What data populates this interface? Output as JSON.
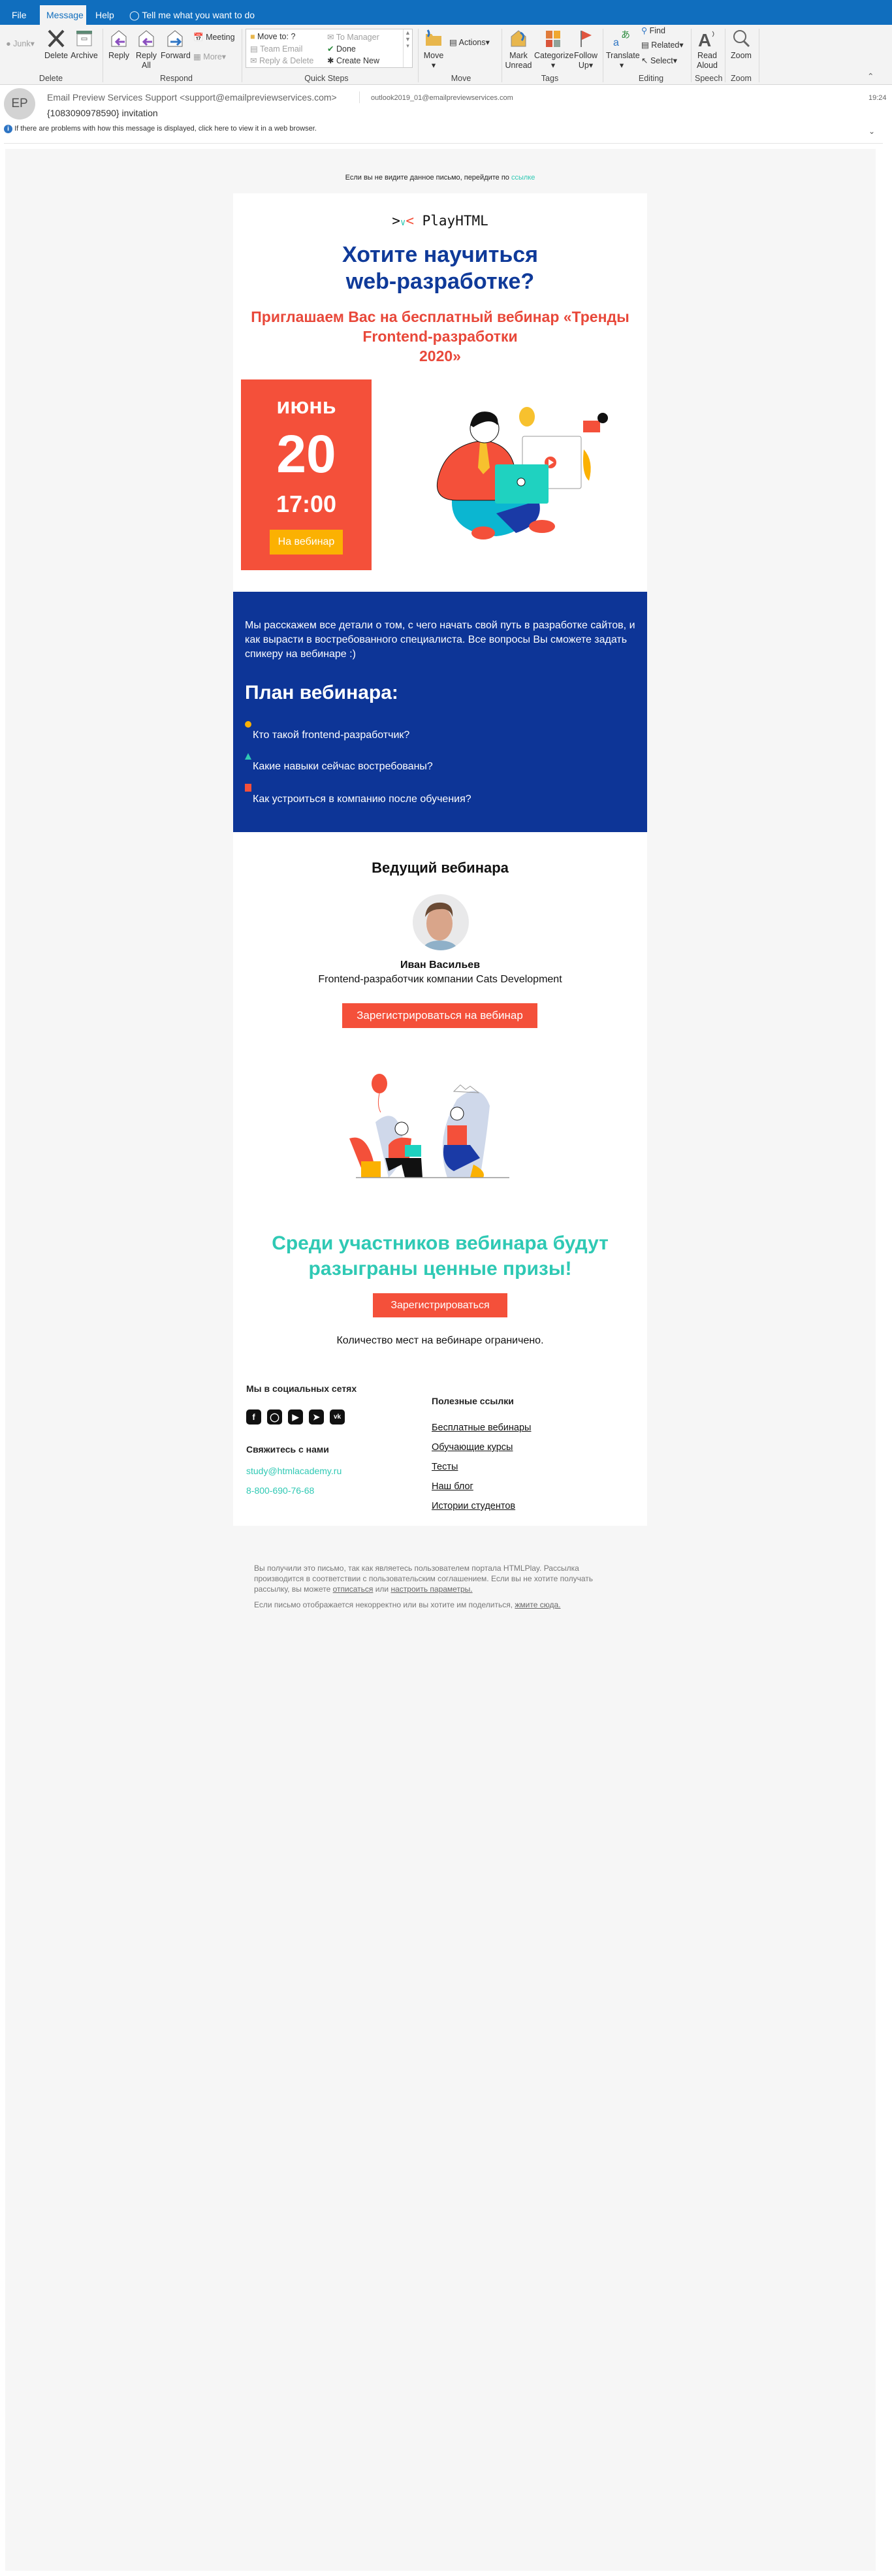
{
  "tabs": {
    "file": "File",
    "message": "Message",
    "help": "Help",
    "tell_me": "Tell me what you want to do"
  },
  "ribbon": {
    "junk": "Junk",
    "delete": "Delete",
    "archive": "Archive",
    "group_delete": "Delete",
    "reply": "Reply",
    "reply_all_1": "Reply",
    "reply_all_2": "All",
    "forward": "Forward",
    "meeting": "Meeting",
    "more": "More",
    "group_respond": "Respond",
    "qs_move_to": "Move to: ?",
    "qs_team_email": "Team Email",
    "qs_reply_delete": "Reply & Delete",
    "qs_to_manager": "To Manager",
    "qs_done": "Done",
    "qs_create_new": "Create New",
    "group_quick_steps": "Quick Steps",
    "move": "Move",
    "actions": "Actions",
    "group_move": "Move",
    "mark_unread_1": "Mark",
    "mark_unread_2": "Unread",
    "categorize": "Categorize",
    "follow_up_1": "Follow",
    "follow_up_2": "Up",
    "group_tags": "Tags",
    "translate": "Translate",
    "find": "Find",
    "related": "Related",
    "select": "Select",
    "group_editing": "Editing",
    "read_aloud_1": "Read",
    "read_aloud_2": "Aloud",
    "group_speech": "Speech",
    "zoom": "Zoom",
    "group_zoom": "Zoom"
  },
  "header": {
    "avatar": "EP",
    "sender": "Email Preview Services Support <support@emailpreviewservices.com>",
    "recipient": "outlook2019_01@emailpreviewservices.com",
    "time": "19:24",
    "subject": "{1083090978590} invitation",
    "info": "If there are problems with how this message is displayed, click here to view it in a web browser."
  },
  "email": {
    "preheader": "Если вы не видите данное письмо, перейдите по ",
    "preheader_link": "ссылке",
    "logo": "PlayHTML",
    "title_1": "Хотите научиться",
    "title_2": "web-разработке?",
    "subtitle_1": "Приглашаем Вас на бесплатный вебинар «Тренды",
    "subtitle_2": "Frontend-разработки",
    "subtitle_3": "2020»",
    "month": "июнь",
    "day": "20",
    "time": "17:00",
    "webinar_button": "На вебинар",
    "intro": "Мы расскажем все детали о том, с чего начать свой путь в разработке сайтов, и как вырасти в востребованного специалиста. Все вопросы Вы сможете задать спикеру на вебинаре :)",
    "plan_title": "План вебинара:",
    "plan": [
      "Кто такой frontend-разработчик?",
      "Какие навыки сейчас востребованы?",
      "Как устроиться в компанию после обучения?"
    ],
    "host_title": "Ведущий вебинара",
    "host_name": "Иван Васильев",
    "host_role": "Frontend-разработчик компании Cats Development",
    "register_webinar": "Зарегистрироваться на вебинар",
    "prizes_1": "Среди участников вебинара будут",
    "prizes_2": "разыграны ценные призы!",
    "register": "Зарегистрироваться",
    "limited": "Количество мест на вебинаре ограничено.",
    "social_title": "Мы в социальных сетях",
    "social": [
      "facebook",
      "instagram",
      "youtube",
      "telegram",
      "vk"
    ],
    "contact_title": "Свяжитесь с нами",
    "email": "study@htmlacademy.ru",
    "phone": "8-800-690-76-68",
    "links_title": "Полезные ссылки",
    "links": [
      "Бесплатные вебинары",
      "Обучающие курсы",
      "Тесты",
      "Наш блог",
      "Истории студентов"
    ]
  },
  "footer": {
    "p1": "Вы получили это письмо, так как являетесь пользователем портала HTMLPlay. Рассылка производится в соответствии с пользовательским соглашением. Если вы не хотите получать рассылку, вы можете ",
    "unsubscribe": "отписаться",
    "or": " или ",
    "settings": "настроить параметры.",
    "p2": "Если письмо отображается некорректно или вы хотите им поделиться, ",
    "here": "жмите сюда."
  },
  "colors": {
    "ribbon": "#106ebe",
    "red": "#f4503a",
    "navy": "#0d3597",
    "yellow": "#fbb102",
    "teal": "#2fc9b4"
  }
}
